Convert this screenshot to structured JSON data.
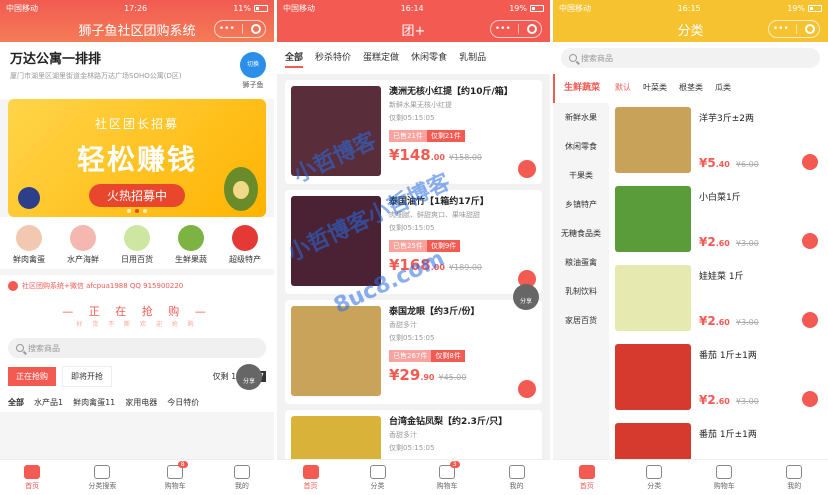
{
  "phone1": {
    "status": {
      "carrier": "中国移动",
      "time": "17:26",
      "battery": "11%"
    },
    "title": "狮子鱼社区团购系统",
    "store": {
      "name": "万达公寓一排排",
      "switch": "切换",
      "address": "厦门市湖里区湖里街道金林路万达广场SOHO公寓(D区)",
      "leader": "狮子鱼"
    },
    "banner": {
      "sub": "社区团长招募",
      "main": "轻松赚钱",
      "pill": "火热招募中"
    },
    "categories": [
      {
        "label": "鲜肉禽蛋",
        "color": "#f2c9b0"
      },
      {
        "label": "水产海鲜",
        "color": "#f5b8b0"
      },
      {
        "label": "日用百货",
        "color": "#cde6a2"
      },
      {
        "label": "生鲜果蔬",
        "color": "#7cb342"
      },
      {
        "label": "超级特产",
        "color": "#e53935"
      }
    ],
    "notice": "社区团购系统+微信 afcpua1988 QQ 915900220",
    "grab_title": "— 正 在 抢 购 —",
    "grab_sub": "好 货 不 断   欢 迎 抢 购",
    "search_placeholder": "搜索商品",
    "share": "分享",
    "time_tabs": {
      "active": "正在抢购",
      "next": "即将开抢",
      "countdown_label": "仅剩 16天",
      "countdown": "07"
    },
    "cat_tabs": [
      "全部",
      "水产品1",
      "鲜肉禽蛋11",
      "家用电器",
      "今日特价"
    ],
    "tabbar": [
      "首页",
      "分类搜索",
      "购物车",
      "我的"
    ],
    "cart_count": "8"
  },
  "phone2": {
    "status": {
      "carrier": "中国移动",
      "time": "16:14",
      "battery": "19%"
    },
    "title": "团+",
    "tabs": [
      "全部",
      "秒杀特价",
      "蛋糕定做",
      "休闲零食",
      "乳制品"
    ],
    "products": [
      {
        "title": "澳洲无核小红提【约10斤/箱】",
        "desc": "新鲜水果无核小红提",
        "time": "仅剩05:15:05",
        "sold": "已售21件",
        "limit": "仅剩21件",
        "price": "148",
        "decimal": ".00",
        "old": "¥158.00",
        "color": "#5a2d3a"
      },
      {
        "title": "泰国油竹【1箱约17斤】",
        "desc": "肉细腻、鲜甜爽口、果味甜甜",
        "time": "仅剩05:15:05",
        "sold": "已售25件",
        "limit": "仅剩9件",
        "price": "168",
        "decimal": ".00",
        "old": "¥189.00",
        "color": "#4a2233"
      },
      {
        "title": "泰国龙眼【约3斤/份】",
        "desc": "香甜多汁",
        "time": "仅剩05:15:05",
        "sold": "已售267件",
        "limit": "仅剩8件",
        "price": "29",
        "decimal": ".90",
        "old": "¥45.00",
        "color": "#c9a35a"
      },
      {
        "title": "台湾金钻凤梨【约2.3斤/只】",
        "desc": "香甜多汁",
        "time": "仅剩05:15:05",
        "sold": "",
        "limit": "",
        "price": "",
        "decimal": "",
        "old": "",
        "color": "#d9b23a"
      }
    ],
    "share": "分享",
    "tabbar": [
      "首页",
      "分类",
      "购物车",
      "我的"
    ],
    "cart_count": "3"
  },
  "phone3": {
    "status": {
      "carrier": "中国移动",
      "time": "16:15",
      "battery": "19%"
    },
    "title": "分类",
    "search_placeholder": "搜索商品",
    "sidebar": [
      "生鲜蔬菜",
      "新鲜水果",
      "休闲零食",
      "干果类",
      "乡镇特产",
      "无糖食品类",
      "粮油蛋禽",
      "乳制饮料",
      "家居百货"
    ],
    "sorts": [
      "默认",
      "叶菜类",
      "根茎类",
      "瓜类"
    ],
    "items": [
      {
        "name": "洋芋3斤±2两",
        "price": "5",
        "decimal": ".40",
        "old": "¥6.00",
        "color": "#c9a25a"
      },
      {
        "name": "小白菜1斤",
        "price": "2",
        "decimal": ".60",
        "old": "¥3.00",
        "color": "#5a9b3a"
      },
      {
        "name": "娃娃菜 1斤",
        "price": "2",
        "decimal": ".60",
        "old": "¥3.00",
        "color": "#e6e9b0"
      },
      {
        "name": "番茄 1斤±1两",
        "price": "2",
        "decimal": ".60",
        "old": "¥3.00",
        "color": "#d6392e"
      },
      {
        "name": "番茄 1斤±1两",
        "price": "",
        "decimal": "",
        "old": "",
        "color": "#d6392e"
      }
    ],
    "tabbar": [
      "首页",
      "分类",
      "购物车",
      "我的"
    ]
  },
  "watermark": [
    "小哲博客",
    "小哲博客小哲博客",
    "8uc8.com"
  ],
  "symbols": {
    "currency": "¥"
  }
}
